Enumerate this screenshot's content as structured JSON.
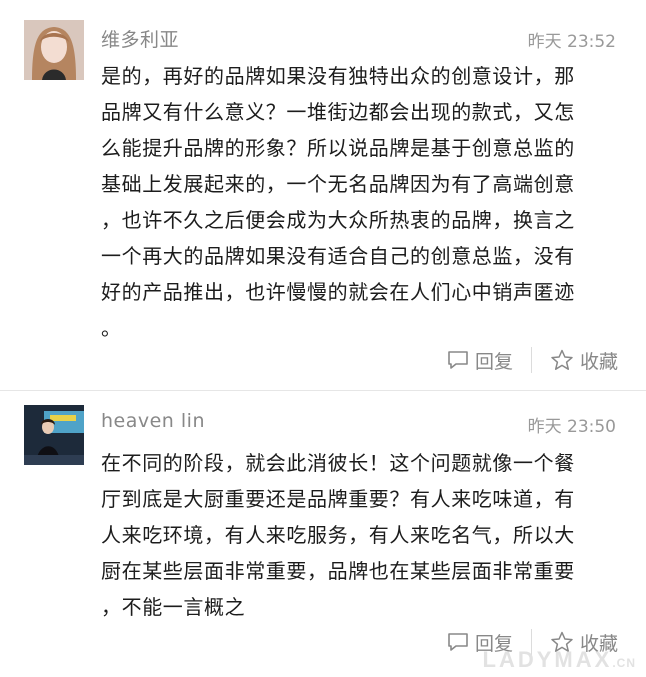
{
  "comments": [
    {
      "username": "维多利亚",
      "time": "昨天 23:52",
      "text": "是的，再好的品牌如果没有独特出众的创意设计，那品牌又有什么意义？一堆街边都会出现的款式，又怎么能提升品牌的形象？所以说品牌是基于创意总监的基础上发展起来的，一个无名品牌因为有了高端创意，也许不久之后便会成为大众所热衷的品牌，换言之一个再大的品牌如果没有适合自己的创意总监，没有好的产品推出，也许慢慢的就会在人们心中销声匿迹。",
      "lines": [
        "是的，再好的品牌如果没有独特出众的创意设计，那",
        "品牌又有什么意义？一堆街边都会出现的款式，又怎",
        "么能提升品牌的形象？所以说品牌是基于创意总监的",
        "基础上发展起来的，一个无名品牌因为有了高端创意",
        "，也许不久之后便会成为大众所热衷的品牌，换言之",
        "一个再大的品牌如果没有适合自己的创意总监，没有",
        "好的产品推出，也许慢慢的就会在人们心中销声匿迹",
        "。"
      ],
      "reply_label": "回复",
      "favorite_label": "收藏"
    },
    {
      "username": "heaven lin",
      "time": "昨天 23:50",
      "lines": [
        "在不同的阶段，就会此消彼长！这个问题就像一个餐",
        "厅到底是大厨重要还是品牌重要？有人来吃味道，有",
        "人来吃环境，有人来吃服务，有人来吃名气，所以大",
        "厨在某些层面非常重要，品牌也在某些层面非常重要",
        "，不能一言概之"
      ],
      "reply_label": "回复",
      "favorite_label": "收藏"
    }
  ],
  "watermark": {
    "main": "LADYMAX",
    "suffix": ".CN"
  },
  "icons": {
    "reply": "comment-bubble-icon",
    "favorite": "star-outline-icon"
  },
  "colors": {
    "muted": "#888888",
    "text": "#1c1c1c",
    "divider": "#e6e6e6"
  }
}
